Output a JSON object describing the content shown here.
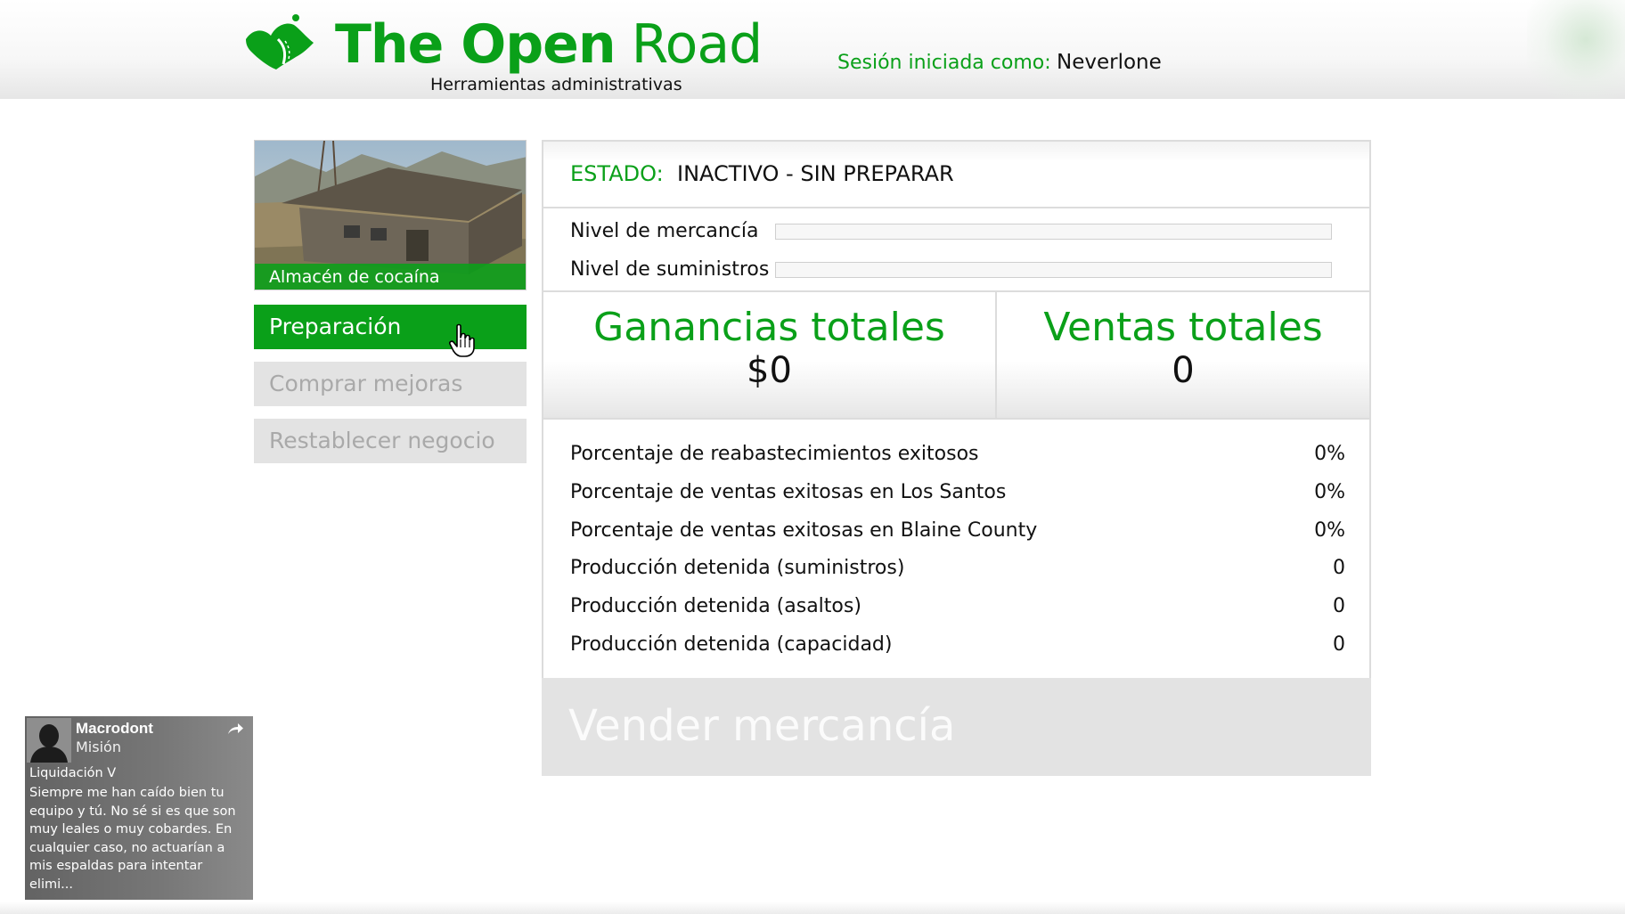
{
  "header": {
    "brand_title_bold": "The Open",
    "brand_title_rest": " Road",
    "brand_subtitle": "Herramientas administrativas",
    "session_label": "Sesión iniciada como:",
    "session_user": "Neverlone"
  },
  "business": {
    "caption": "Almacén de cocaína"
  },
  "menu": {
    "items": [
      {
        "label": "Preparación",
        "state": "active"
      },
      {
        "label": "Comprar mejoras",
        "state": "disabled"
      },
      {
        "label": "Restablecer negocio",
        "state": "disabled"
      }
    ]
  },
  "status": {
    "label": "ESTADO:",
    "value": "INACTIVO - SIN PREPARAR"
  },
  "levels": {
    "stock_label": "Nivel de mercancía",
    "stock_fraction": 0,
    "supplies_label": "Nivel de suministros",
    "supplies_fraction": 0
  },
  "totals": {
    "earnings_title": "Ganancias totales",
    "earnings_value": "$0",
    "sales_title": "Ventas totales",
    "sales_value": "0"
  },
  "stats": [
    {
      "label": "Porcentaje de reabastecimientos exitosos",
      "value": "0%"
    },
    {
      "label": "Porcentaje de ventas exitosas en Los Santos",
      "value": "0%"
    },
    {
      "label": "Porcentaje de ventas exitosas en Blaine County",
      "value": "0%"
    },
    {
      "label": "Producción detenida (suministros)",
      "value": "0"
    },
    {
      "label": "Producción detenida (asaltos)",
      "value": "0"
    },
    {
      "label": "Producción detenida (capacidad)",
      "value": "0"
    }
  ],
  "sell_button": {
    "label": "Vender mercancía"
  },
  "notification": {
    "sender": "Macrodont",
    "type": "Misión",
    "subject": "Liquidación V",
    "body": "Siempre me han caído bien tu equipo y tú. No sé si es que son muy leales o muy cobardes. En cualquier caso, no actuarían a mis espaldas para intentar elimi...",
    "share_icon": "share-arrow-icon"
  },
  "colors": {
    "accent_green": "#0aa019",
    "disabled_gray": "#e3e3e3"
  }
}
